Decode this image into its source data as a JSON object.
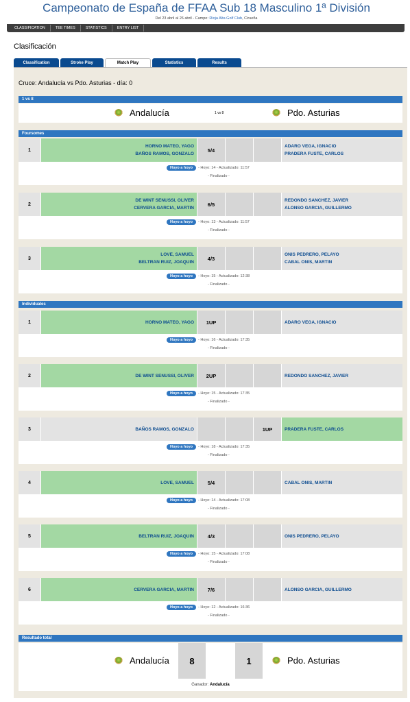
{
  "header": {
    "title": "Campeonato de España de FFAA Sub 18 Masculino 1ª División",
    "dates": "Del 23 abril al 26 abril - Campo:",
    "course": "Rioja Alta Golf Club",
    "city": ", Cirueña"
  },
  "topnav": [
    "CLASSIFICATION",
    "TEE TIMES",
    "STATISTICS",
    "ENTRY LIST"
  ],
  "section_title": "Clasificación",
  "tabs": [
    {
      "label": "Classification"
    },
    {
      "label": "Stroke Play"
    },
    {
      "label": "Match Play",
      "active": true
    },
    {
      "label": "Statistics"
    },
    {
      "label": "Results"
    }
  ],
  "cruce": "Cruce: Andalucía vs Pdo. Asturias - día: 0",
  "vs_bar": "1 vs 8",
  "team_a": "Andalucía",
  "team_b": "Pdo. Asturias",
  "vs_label": "1 vs 8",
  "foursomes_label": "Foursomes",
  "individuales_label": "Individuales",
  "total_label": "Resultado total",
  "button_label": "Hoyo a hoyo",
  "foursomes": [
    {
      "n": "1",
      "left": [
        "HORNO MATEO, YAGO",
        "BAÑOS RAMOS, GONZALO"
      ],
      "r1": "5/4",
      "r3": "",
      "right": [
        "ADARO VEGA, IGNACIO",
        "PRADERA FUSTE, CARLOS"
      ],
      "winner": "left",
      "hoyo": "- Hoyo: 14 - Actualizado: 11:57",
      "status": "- Finalizado -"
    },
    {
      "n": "2",
      "left": [
        "DE WINT SENUSSI, OLIVER",
        "CERVERA GARCIA, MARTIN"
      ],
      "r1": "6/5",
      "r3": "",
      "right": [
        "REDONDO SANCHEZ, JAVIER",
        "ALONSO GARCIA, GUILLERMO"
      ],
      "winner": "left",
      "hoyo": "- Hoyo: 13 - Actualizado: 11:57",
      "status": "- Finalizado -"
    },
    {
      "n": "3",
      "left": [
        "LOVE, SAMUEL",
        "BELTRAN RUIZ, JOAQUIN"
      ],
      "r1": "4/3",
      "r3": "",
      "right": [
        "ONIS PEDRERO, PELAYO",
        "CABAL ONIS, MARTIN"
      ],
      "winner": "left",
      "hoyo": "- Hoyo: 15 - Actualizado: 12:38",
      "status": "- Finalizado -"
    }
  ],
  "individuales": [
    {
      "n": "1",
      "left": [
        "HORNO MATEO, YAGO"
      ],
      "r1": "1UP",
      "r3": "",
      "right": [
        "ADARO VEGA, IGNACIO"
      ],
      "winner": "left",
      "hoyo": "- Hoyo: 16 - Actualizado: 17:35",
      "status": "- Finalizado -"
    },
    {
      "n": "2",
      "left": [
        "DE WINT SENUSSI, OLIVER"
      ],
      "r1": "2UP",
      "r3": "",
      "right": [
        "REDONDO SANCHEZ, JAVIER"
      ],
      "winner": "left",
      "hoyo": "- Hoyo: 15 - Actualizado: 17:35",
      "status": "- Finalizado -"
    },
    {
      "n": "3",
      "left": [
        "BAÑOS RAMOS, GONZALO"
      ],
      "r1": "",
      "r3": "1UP",
      "right": [
        "PRADERA FUSTE, CARLOS"
      ],
      "winner": "right",
      "hoyo": "- Hoyo: 18 - Actualizado: 17:35",
      "status": "- Finalizado -"
    },
    {
      "n": "4",
      "left": [
        "LOVE, SAMUEL"
      ],
      "r1": "5/4",
      "r3": "",
      "right": [
        "CABAL ONIS, MARTIN"
      ],
      "winner": "left",
      "hoyo": "- Hoyo: 14 - Actualizado: 17:08",
      "status": "- Finalizado -"
    },
    {
      "n": "5",
      "left": [
        "BELTRAN RUIZ, JOAQUIN"
      ],
      "r1": "4/3",
      "r3": "",
      "right": [
        "ONIS PEDRERO, PELAYO"
      ],
      "winner": "left",
      "hoyo": "- Hoyo: 15 - Actualizado: 17:08",
      "status": "- Finalizado -"
    },
    {
      "n": "6",
      "left": [
        "CERVERA GARCIA, MARTIN"
      ],
      "r1": "7/6",
      "r3": "",
      "right": [
        "ALONSO GARCIA, GUILLERMO"
      ],
      "winner": "left",
      "hoyo": "- Hoyo: 12 - Actualizado: 16:36",
      "status": "- Finalizado -"
    }
  ],
  "total": {
    "a": "8",
    "b": "1"
  },
  "winner_prefix": "Ganador:",
  "winner_name": "Andalucía",
  "colors": {
    "header_blue": "#2e5f9a",
    "bar_blue": "#2f76c0",
    "tab_blue": "#0a4a8f",
    "win_green": "#a3d8a3",
    "panel_bg": "#eeeae0"
  }
}
